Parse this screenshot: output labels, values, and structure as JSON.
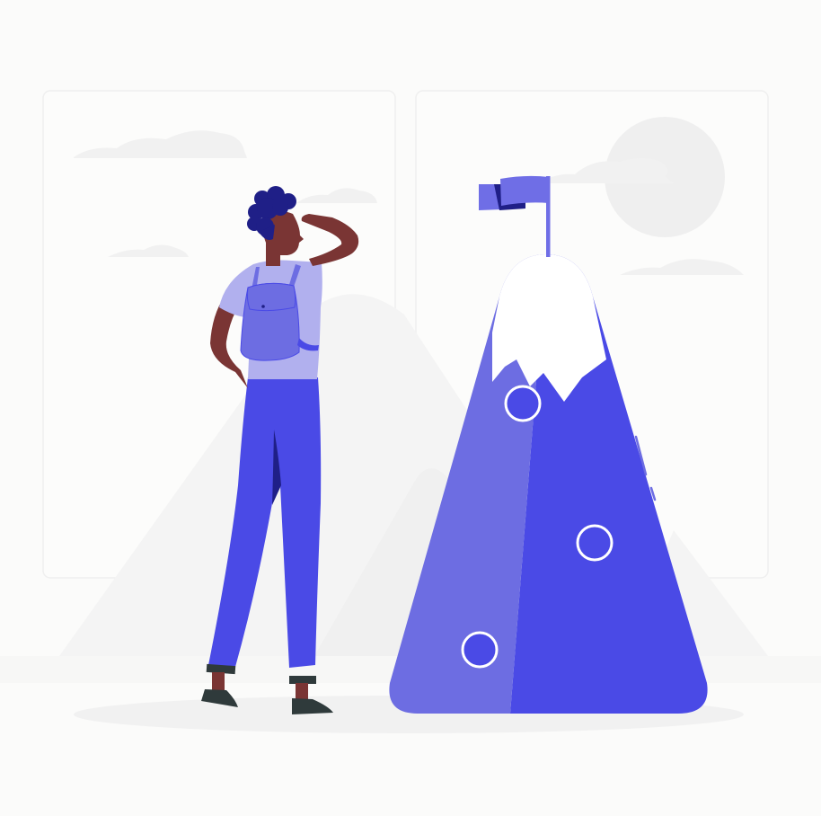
{
  "illustration": {
    "subject": "",
    "colors": {
      "background": "#fbfbfa",
      "panel": "#fcfcfb",
      "panel_border": "#efefef",
      "haze": "#f3f3f3",
      "primary": "#4a4ae6",
      "primary_light": "#6d6de2",
      "primary_pale": "#b1b0ee",
      "hair": "#1f1f87",
      "skin": "#7a3534",
      "shoe": "#2f3a3b",
      "snow": "#ffffff",
      "flag": "#6f6ee6",
      "flag_dark": "#1f1f87"
    },
    "icons": {
      "person": "hiker-figure",
      "pack": "backpack",
      "peak": "mountain-peak",
      "banner": "summit-flag",
      "sun": "sun-circle"
    }
  }
}
